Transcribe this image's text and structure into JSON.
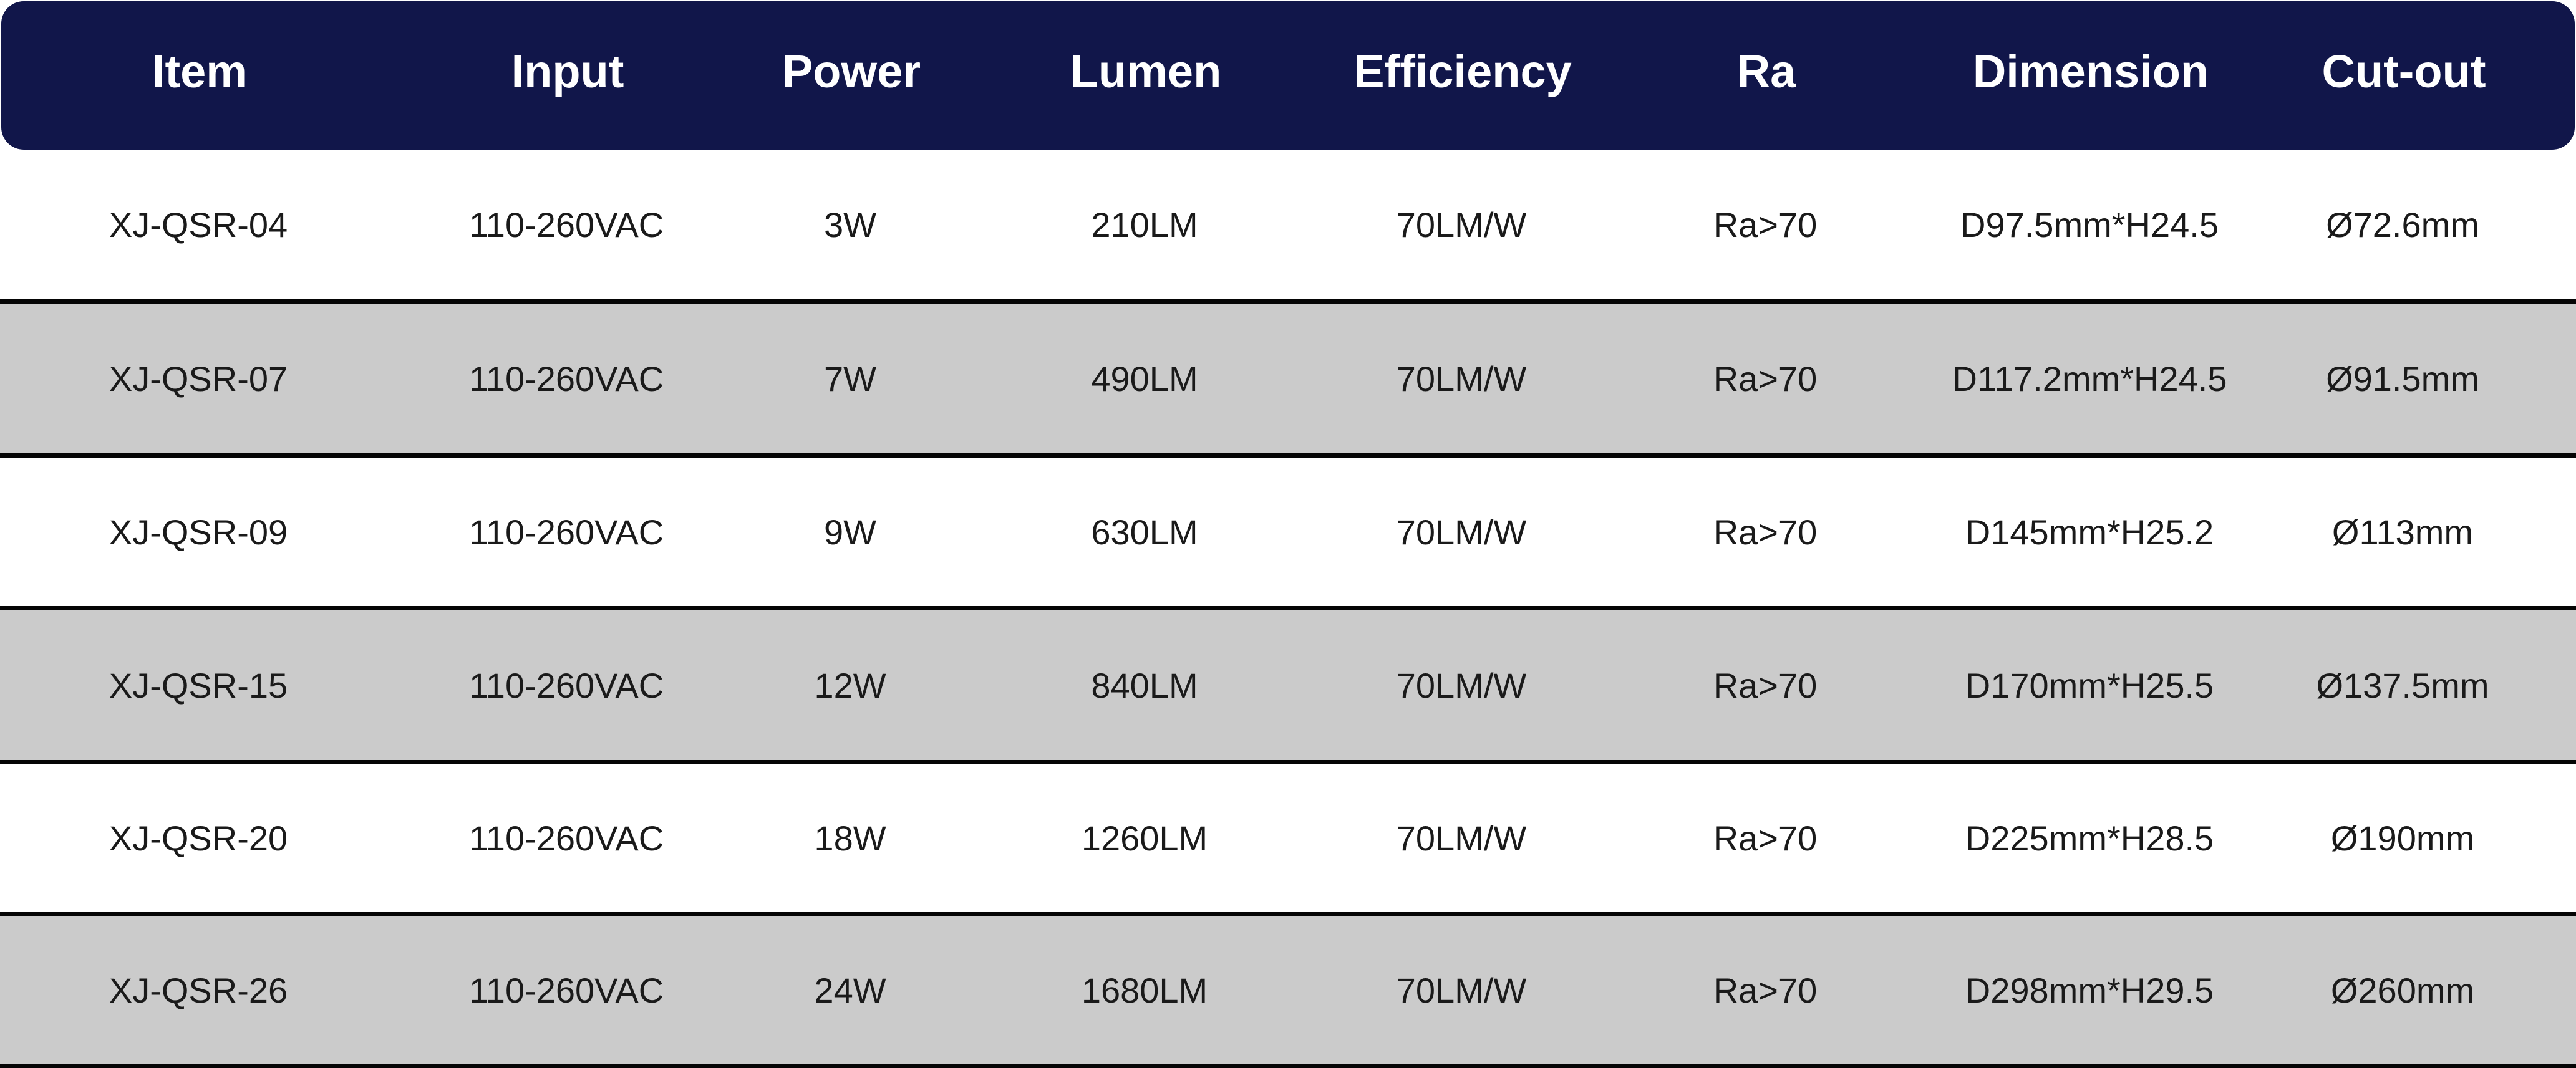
{
  "colors": {
    "header_bg": "#11164a",
    "header_text": "#ffffff",
    "row_shaded": "#cbcbcb",
    "row_plain": "#ffffff",
    "divider": "#050505",
    "cell_text": "#1a1a1a"
  },
  "table": {
    "headers": [
      "Item",
      "Input",
      "Power",
      "Lumen",
      "Efficiency",
      "Ra",
      "Dimension",
      "Cut-out"
    ],
    "rows": [
      [
        "XJ-QSR-04",
        "110-260VAC",
        "3W",
        "210LM",
        "70LM/W",
        "Ra>70",
        "D97.5mm*H24.5",
        "Ø72.6mm"
      ],
      [
        "XJ-QSR-07",
        "110-260VAC",
        "7W",
        "490LM",
        "70LM/W",
        "Ra>70",
        "D117.2mm*H24.5",
        "Ø91.5mm"
      ],
      [
        "XJ-QSR-09",
        "110-260VAC",
        "9W",
        "630LM",
        "70LM/W",
        "Ra>70",
        "D145mm*H25.2",
        "Ø113mm"
      ],
      [
        "XJ-QSR-15",
        "110-260VAC",
        "12W",
        "840LM",
        "70LM/W",
        "Ra>70",
        "D170mm*H25.5",
        "Ø137.5mm"
      ],
      [
        "XJ-QSR-20",
        "110-260VAC",
        "18W",
        "1260LM",
        "70LM/W",
        "Ra>70",
        "D225mm*H28.5",
        "Ø190mm"
      ],
      [
        "XJ-QSR-26",
        "110-260VAC",
        "24W",
        "1680LM",
        "70LM/W",
        "Ra>70",
        "D298mm*H29.5",
        "Ø260mm"
      ]
    ]
  }
}
